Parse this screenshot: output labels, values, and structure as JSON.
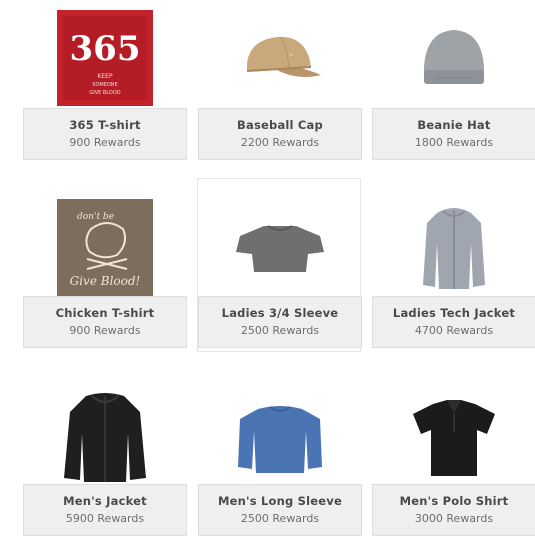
{
  "products": [
    {
      "name": "365 T-shirt",
      "reward": "900 Rewards",
      "icon": "red-tshirt-365-image",
      "print": {
        "big": "365",
        "small1": "KEEP",
        "small2": "SOMEONE",
        "small3": "GIVE BLOOD"
      }
    },
    {
      "name": "Baseball Cap",
      "reward": "2200 Rewards",
      "icon": "baseball-cap-image"
    },
    {
      "name": "Beanie Hat",
      "reward": "1800 Rewards",
      "icon": "beanie-hat-image"
    },
    {
      "name": "Chicken T-shirt",
      "reward": "900 Rewards",
      "icon": "chicken-tshirt-image",
      "print": {
        "top": "don't be",
        "bottom": "Give Blood!"
      }
    },
    {
      "name": "Ladies 3/4 Sleeve",
      "reward": "2500 Rewards",
      "icon": "ladies-sleeve-shirt-image"
    },
    {
      "name": "Ladies Tech Jacket",
      "reward": "4700 Rewards",
      "icon": "ladies-tech-jacket-image"
    },
    {
      "name": "Men's Jacket",
      "reward": "5900 Rewards",
      "icon": "mens-jacket-image"
    },
    {
      "name": "Men's Long Sleeve",
      "reward": "2500 Rewards",
      "icon": "mens-long-sleeve-image"
    },
    {
      "name": "Men's Polo Shirt",
      "reward": "3000 Rewards",
      "icon": "mens-polo-shirt-image"
    }
  ],
  "colors": {
    "caption_bg": "#efefef",
    "red_shirt": "#c4222b",
    "tan_cap": "#c9a87c",
    "grey_beanie": "#9ea3a8",
    "brown_shirt": "#7d6d5c"
  }
}
